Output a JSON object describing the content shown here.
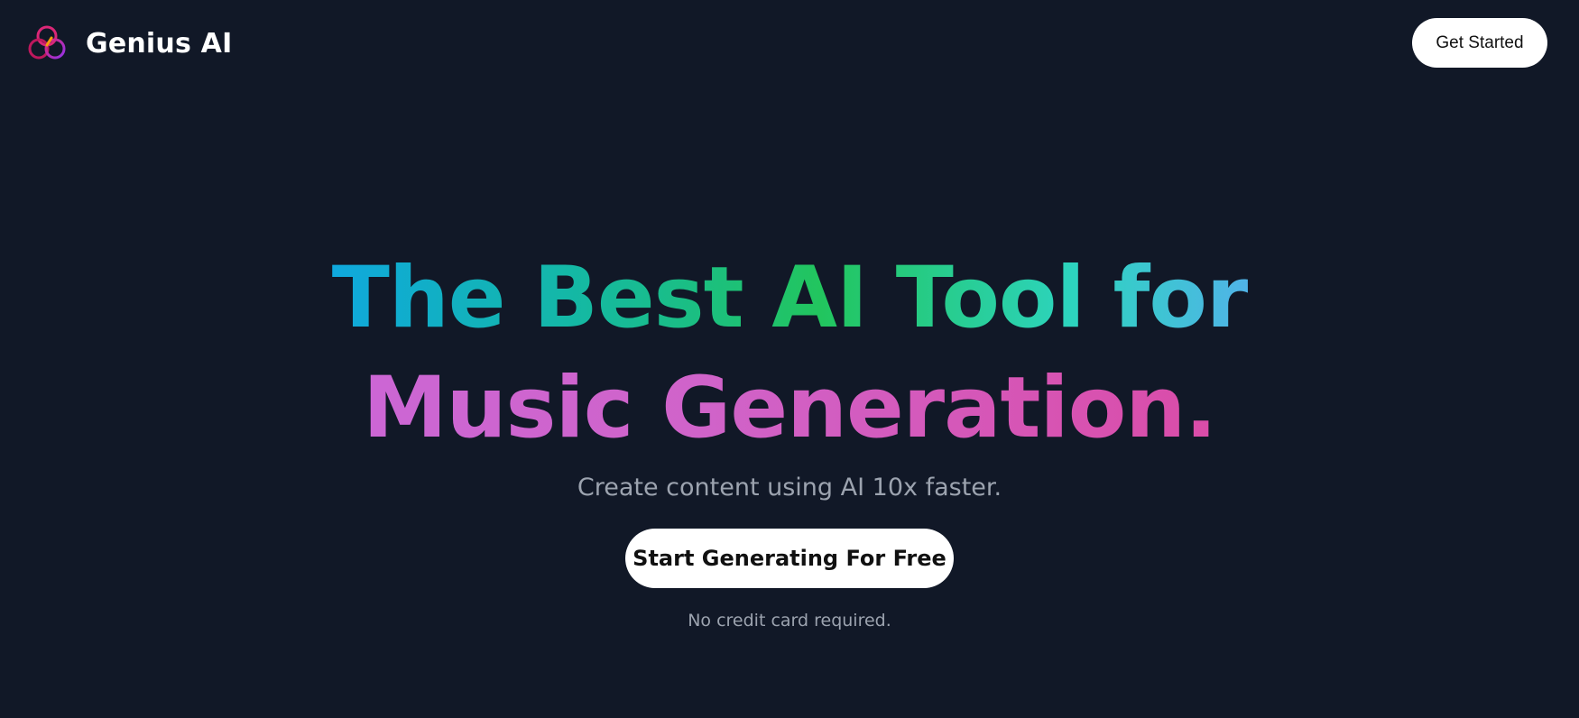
{
  "navbar": {
    "brand_name": "Genius AI",
    "brand_icon": "logo-icon",
    "cta_label": "Get Started"
  },
  "hero": {
    "headline_line1": "The Best AI Tool for",
    "headline_line2": "Music Generation.",
    "subheadline": "Create content using AI 10x faster.",
    "cta_label": "Start Generating For Free",
    "note": "No credit card required."
  },
  "colors": {
    "background": "#111827",
    "button_bg": "#ffffff",
    "muted_text": "#9ca3af",
    "gradient_line1": [
      "#2563eb",
      "#14b8a6",
      "#22c55e",
      "#60a5fa",
      "#818cf8"
    ],
    "gradient_line2": [
      "#c76ae0",
      "#db4aa5",
      "#e43f8f"
    ]
  }
}
